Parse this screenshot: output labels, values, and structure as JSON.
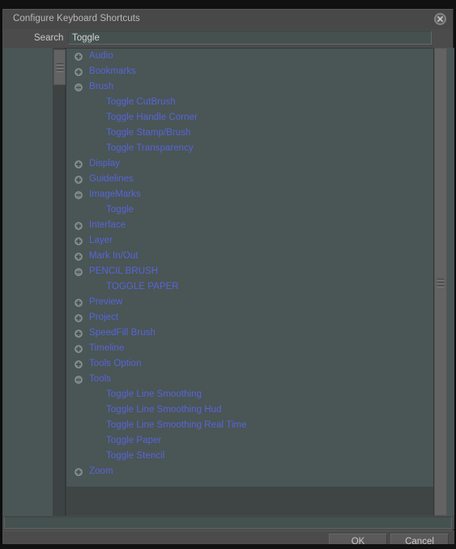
{
  "window": {
    "title": "Configure Keyboard Shortcuts",
    "close_icon": "close-circle-icon"
  },
  "search": {
    "label": "Search",
    "value": "Toggle",
    "placeholder": ""
  },
  "tree": {
    "expand_icon": "plus-circle-icon",
    "collapse_icon": "minus-circle-icon",
    "items": [
      {
        "label": "Audio",
        "level": "parent",
        "state": "collapsed"
      },
      {
        "label": "Bookmarks",
        "level": "parent",
        "state": "collapsed"
      },
      {
        "label": "Brush",
        "level": "parent",
        "state": "expanded"
      },
      {
        "label": "Toggle CutBrush",
        "level": "child",
        "state": "leaf"
      },
      {
        "label": "Toggle Handle Corner",
        "level": "child",
        "state": "leaf"
      },
      {
        "label": "Toggle Stamp/Brush",
        "level": "child",
        "state": "leaf"
      },
      {
        "label": "Toggle Transparency",
        "level": "child",
        "state": "leaf"
      },
      {
        "label": "Display",
        "level": "parent",
        "state": "collapsed"
      },
      {
        "label": "Guidelines",
        "level": "parent",
        "state": "collapsed"
      },
      {
        "label": "ImageMarks",
        "level": "parent",
        "state": "expanded"
      },
      {
        "label": "Toggle",
        "level": "child",
        "state": "leaf"
      },
      {
        "label": "Interface",
        "level": "parent",
        "state": "collapsed"
      },
      {
        "label": "Layer",
        "level": "parent",
        "state": "collapsed"
      },
      {
        "label": "Mark In/Out",
        "level": "parent",
        "state": "collapsed"
      },
      {
        "label": "PENCIL BRUSH",
        "level": "parent",
        "state": "expanded"
      },
      {
        "label": "TOGGLE PAPER",
        "level": "child",
        "state": "leaf"
      },
      {
        "label": "Preview",
        "level": "parent",
        "state": "collapsed"
      },
      {
        "label": "Project",
        "level": "parent",
        "state": "collapsed"
      },
      {
        "label": "SpeedFill Brush",
        "level": "parent",
        "state": "collapsed"
      },
      {
        "label": "Timeline",
        "level": "parent",
        "state": "collapsed"
      },
      {
        "label": "Tools Option",
        "level": "parent",
        "state": "collapsed"
      },
      {
        "label": "Tools",
        "level": "parent",
        "state": "expanded"
      },
      {
        "label": "Toggle Line Smoothing",
        "level": "child",
        "state": "leaf"
      },
      {
        "label": "Toggle Line Smoothing Hud",
        "level": "child",
        "state": "leaf"
      },
      {
        "label": "Toggle Line Smoothing Real Time",
        "level": "child",
        "state": "leaf"
      },
      {
        "label": "Toggle Paper",
        "level": "child",
        "state": "leaf"
      },
      {
        "label": "Toggle Stencil",
        "level": "child",
        "state": "leaf"
      },
      {
        "label": "Zoom",
        "level": "parent",
        "state": "collapsed"
      }
    ]
  },
  "scrollbars": {
    "left_vertical": "vertical-scrollbar",
    "right_vertical": "vertical-scrollbar",
    "bottom_horizontal": "horizontal-scrollbar"
  },
  "footer": {
    "ok_label": "OK",
    "cancel_label": "Cancel"
  },
  "colors": {
    "dialog_bg": "#4b4b4b",
    "panel_bg": "#4a5555",
    "list_bg": "#3f4545",
    "item_text": "#5765d8",
    "label_text": "#c8c8c8",
    "input_bg": "#44514f"
  }
}
